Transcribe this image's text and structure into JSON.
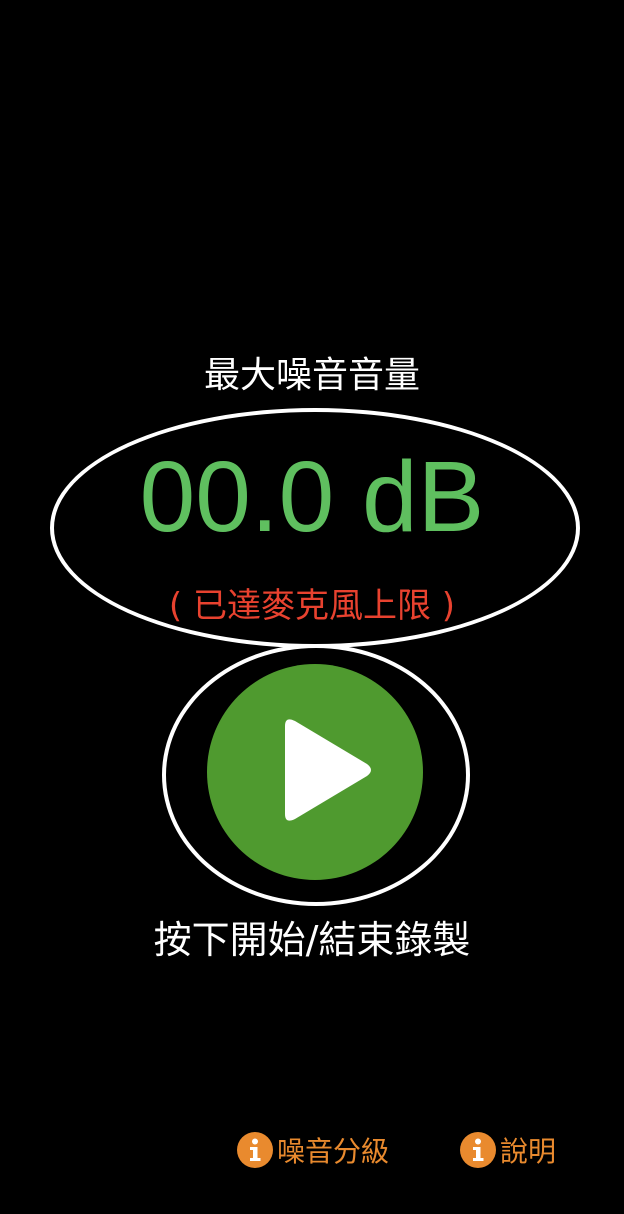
{
  "meter": {
    "title": "最大噪音音量",
    "value_text": "00.0 dB",
    "limit_note": "( 已達麥克風上限 )"
  },
  "record": {
    "play_icon": "play-icon",
    "label": "按下開始/結束錄製"
  },
  "footer": {
    "noise_levels_label": "噪音分級",
    "help_label": "說明",
    "icon": "info-icon"
  },
  "colors": {
    "background": "#000000",
    "value_green": "#5fbf5f",
    "warning_red": "#e8422f",
    "button_green": "#4f9a2f",
    "link_orange": "#e98a2e",
    "outline_white": "#ffffff"
  }
}
